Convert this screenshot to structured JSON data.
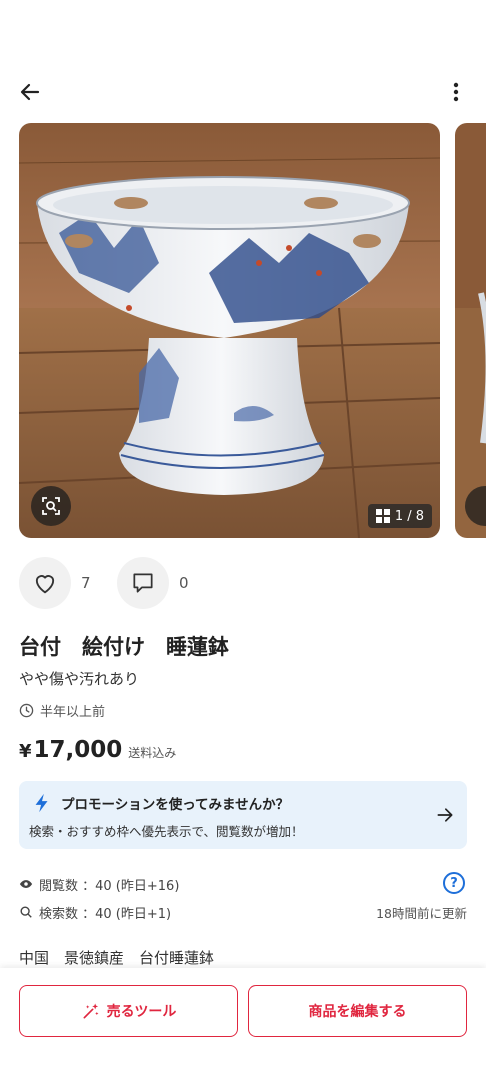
{
  "header": {
    "back_icon": "arrow-left-icon",
    "menu_icon": "more-vertical-icon"
  },
  "gallery": {
    "counter": "1 / 8",
    "lens_icon": "image-search-icon",
    "grid_icon": "grid-icon"
  },
  "actions": {
    "likes": "7",
    "comments": "0"
  },
  "item": {
    "title": "台付　絵付け　睡蓮鉢",
    "condition": "やや傷や汚れあり",
    "listed": "半年以上前",
    "price_yen": "¥",
    "price": "17,000",
    "shipping": "送料込み"
  },
  "promo": {
    "title": "プロモーションを使ってみませんか？",
    "subtitle": "検索・おすすめ枠へ優先表示で、閲覧数が増加！"
  },
  "stats": {
    "views": "閲覧数 ：40 (昨日+16)",
    "searches": "検索数 ：40 (昨日+1)",
    "updated": "18時間前に更新",
    "help": "?"
  },
  "tags": "中国　景徳鎮産　台付睡蓮鉢",
  "bottom": {
    "sell_tools": "売るツール",
    "edit_item": "商品を編集する"
  },
  "colors": {
    "accent": "#e0263f",
    "promo_bg": "#e8f2fb",
    "link_blue": "#1e6fd9"
  }
}
